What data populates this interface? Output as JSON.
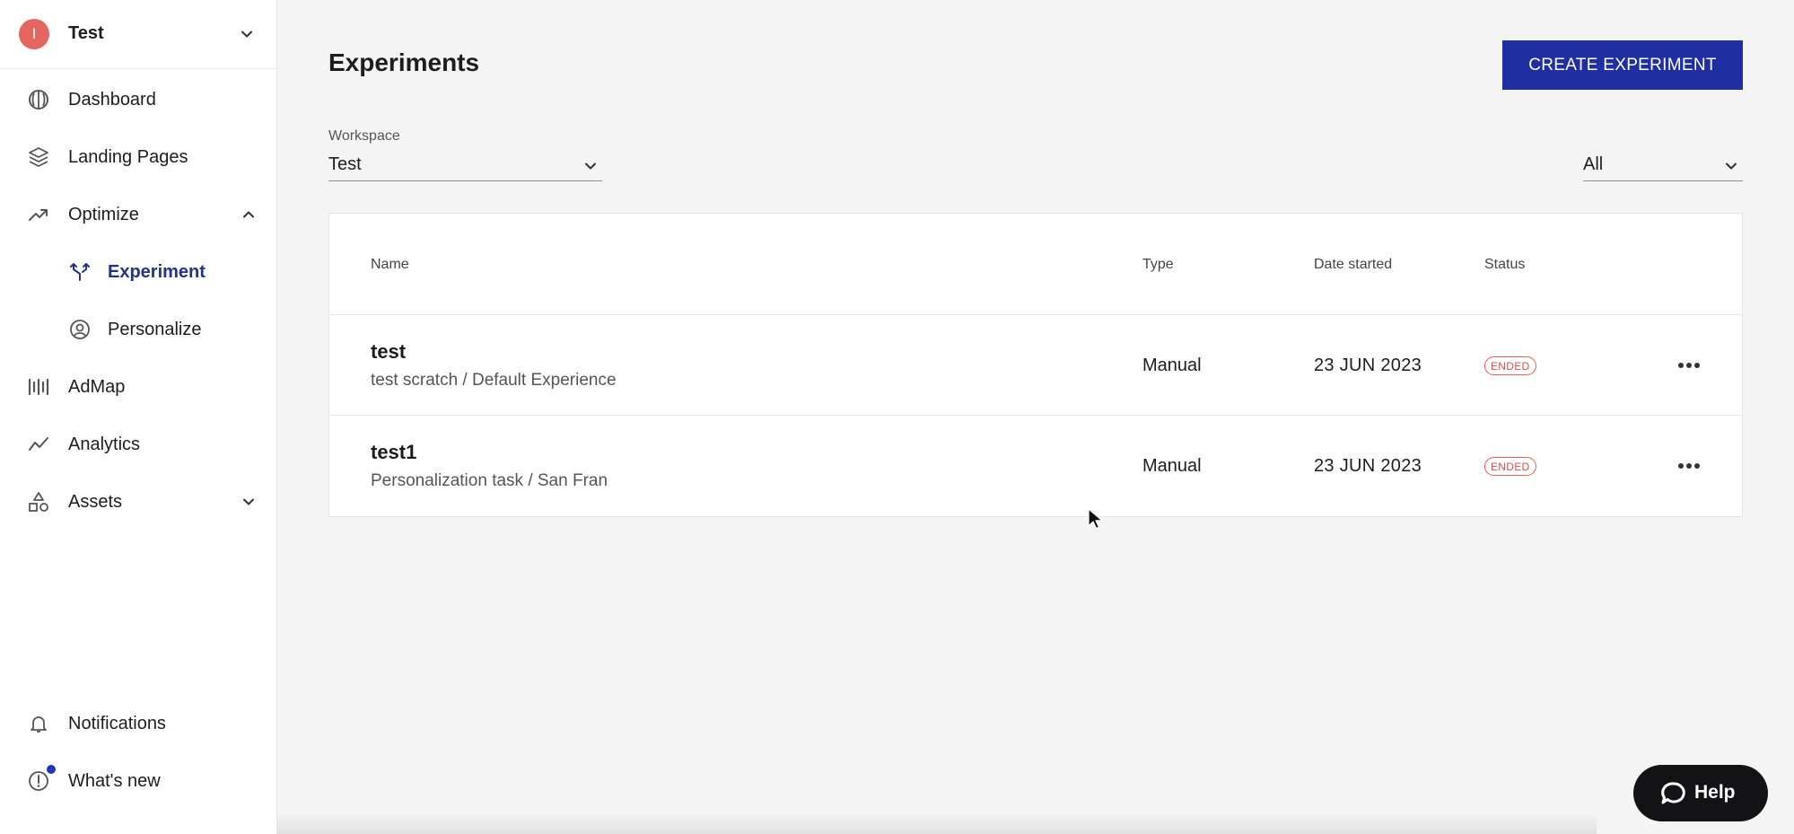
{
  "workspace_switcher": {
    "avatar_letter": "I",
    "name": "Test",
    "avatar_color": "#e5665f"
  },
  "sidebar": {
    "items": [
      {
        "label": "Dashboard",
        "icon": "dashboard-icon"
      },
      {
        "label": "Landing Pages",
        "icon": "layers-icon"
      },
      {
        "label": "Optimize",
        "icon": "trend-up-icon",
        "expanded": true
      },
      {
        "label": "Experiment",
        "icon": "split-arrows-icon",
        "active": true
      },
      {
        "label": "Personalize",
        "icon": "user-circle-icon"
      },
      {
        "label": "AdMap",
        "icon": "admap-icon"
      },
      {
        "label": "Analytics",
        "icon": "line-chart-icon"
      },
      {
        "label": "Assets",
        "icon": "shapes-icon",
        "expanded": false
      }
    ],
    "footer": [
      {
        "label": "Notifications",
        "icon": "bell-icon"
      },
      {
        "label": "What's new",
        "icon": "info-icon",
        "has_dot": true
      }
    ]
  },
  "main": {
    "title": "Experiments",
    "create_button": "CREATE EXPERIMENT",
    "workspace_label": "Workspace",
    "workspace_value": "Test",
    "filter_value": "All",
    "table": {
      "headers": {
        "name": "Name",
        "type": "Type",
        "date": "Date started",
        "status": "Status"
      },
      "rows": [
        {
          "name": "test",
          "sub": "test scratch / Default Experience",
          "type": "Manual",
          "date": "23 JUN 2023",
          "status": "ENDED"
        },
        {
          "name": "test1",
          "sub": "Personalization task / San Fran",
          "type": "Manual",
          "date": "23 JUN 2023",
          "status": "ENDED"
        }
      ]
    }
  },
  "help": {
    "label": "Help"
  },
  "colors": {
    "accent": "#1f2fa2",
    "active_nav": "#23318f",
    "ended": "#d9534f",
    "dot": "#1f35b4"
  }
}
